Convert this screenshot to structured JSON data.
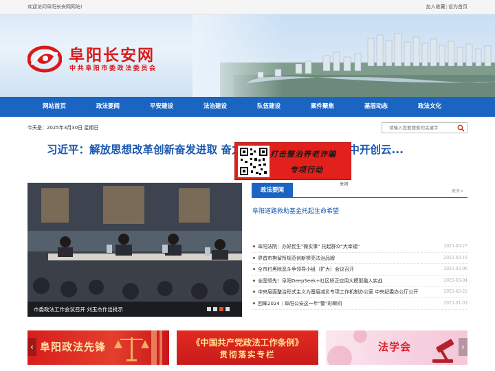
{
  "topbar": {
    "welcome": "欢迎访问阜阳长安网网站!",
    "bookmark": "加入收藏",
    "separator": "|",
    "homepage": "设为首页"
  },
  "header": {
    "title": "阜阳长安网",
    "subtitle": "中共阜阳市委政法委员会"
  },
  "nav": {
    "items": [
      "网站首页",
      "政法要闻",
      "平安建设",
      "法治建设",
      "队伍建设",
      "案件聚焦",
      "基层动态",
      "政法文化"
    ]
  },
  "datebar": {
    "text": "今天是：2025年3月30日 星期日"
  },
  "search": {
    "placeholder": "请输入您要搜索的关键字"
  },
  "headline": "习近平：解放思想改革创新奋发进取 奋力谱写中国式现代化进程中开创云...",
  "popup": {
    "line1": "打击整治养老诈骗",
    "line2": "专项行动",
    "close": "关闭"
  },
  "slideshow": {
    "caption": "市委政法工作会议召开 刘玉杰作出批示",
    "active_index": 2,
    "count": 4
  },
  "news_panel": {
    "tab": "政法要闻",
    "more": "更多>",
    "top_story": "阜阳道路救助基金托起生命希望",
    "items": [
      {
        "title": "阜阳法院：办好民生\"微实事\" 托起群众\"大幸福\"",
        "date": "2025-03-27"
      },
      {
        "title": "界首市拘留所规范创新擦亮法治品牌",
        "date": "2025-03-16"
      },
      {
        "title": "全市扫黑除恶斗争领导小组（扩大）会议召开",
        "date": "2025-03-06"
      },
      {
        "title": "全国领先！阜阳DeepSeek+社区矫正应用大模型融入实战",
        "date": "2025-03-04"
      },
      {
        "title": "中央层面整治形式主义为基层减负专项工作机制办公室 中央纪委办公厅公开",
        "date": "2025-02-21"
      },
      {
        "title": "回眸2024｜阜阳公安这一年\"警\"彩瞬间",
        "date": "2025-01-03"
      }
    ]
  },
  "ads": {
    "ad1": "阜阳政法先锋",
    "ad2_line1": "《中国共产党政法工作条例》",
    "ad2_line2": "贯彻落实专栏",
    "ad3": "法学会"
  },
  "arrows": {
    "prev": "‹",
    "next": "›"
  },
  "colors": {
    "brand_red": "#d91a1a",
    "nav_blue": "#1a65c2",
    "link_blue": "#1a57b0",
    "active_dot": "#e2531d"
  }
}
